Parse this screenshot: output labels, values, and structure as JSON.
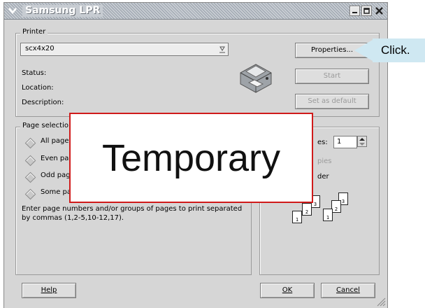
{
  "window": {
    "title": "Samsung LPR"
  },
  "printer_group": {
    "legend": "Printer",
    "selected_printer": "scx4x20",
    "status_label": "Status:",
    "location_label": "Location:",
    "description_label": "Description:",
    "properties_label": "Properties...",
    "start_label": "Start",
    "set_default_label": "Set as default"
  },
  "page_selection": {
    "legend": "Page selectio",
    "options": [
      "All pages",
      "Even pa",
      "Odd pag",
      "Some pa"
    ],
    "hint": "Enter page numbers and/or groups of pages to print separated by commas (1,2-5,10-12,17)."
  },
  "copies": {
    "label": "es:",
    "value": "1",
    "collate_label": "pies",
    "reverse_label": "der"
  },
  "footer": {
    "help_label": "Help",
    "ok_label": "OK",
    "cancel_label": "Cancel"
  },
  "overlay": {
    "watermark_text": "Temporary",
    "callout_text": "Click."
  },
  "colors": {
    "watermark_border": "#d01a1a",
    "callout_bg": "#cfe8f2"
  }
}
